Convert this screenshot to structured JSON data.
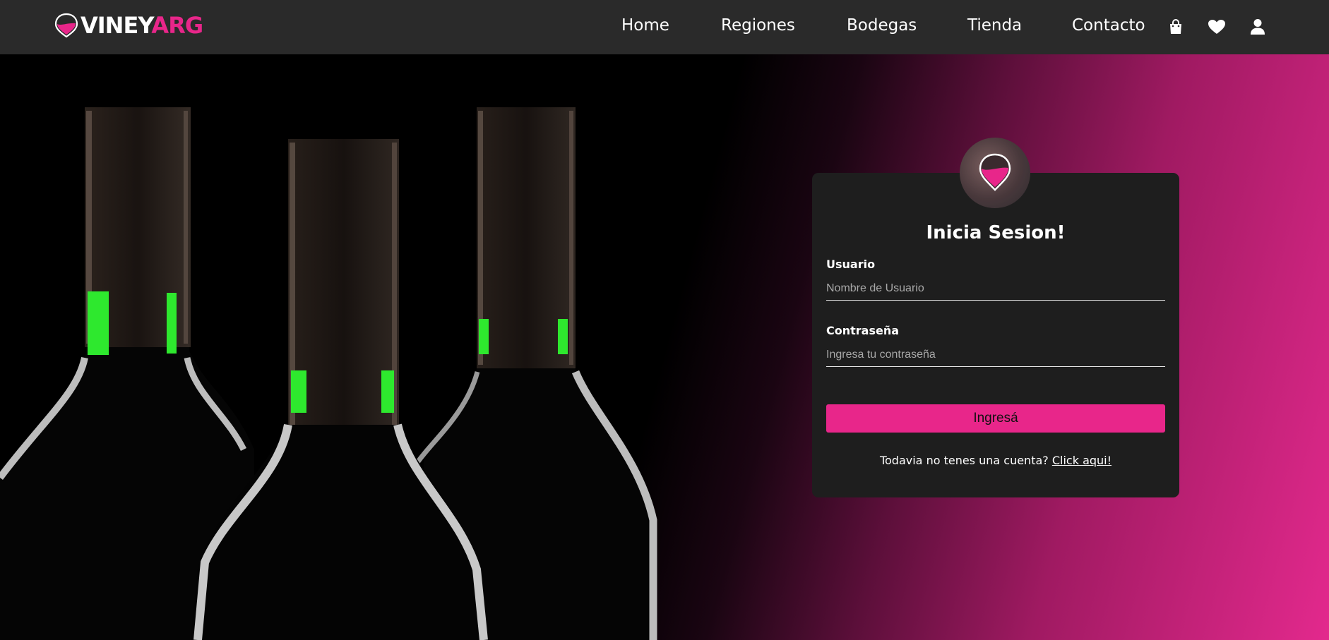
{
  "brand": {
    "logo_part1": "VINEY",
    "logo_part2": "ARG",
    "colors": {
      "accent": "#e8268a",
      "navbar": "#2a2a2a",
      "card": "#1e1e1e"
    }
  },
  "nav": {
    "links": [
      {
        "label": "Home"
      },
      {
        "label": "Regiones"
      },
      {
        "label": "Bodegas"
      },
      {
        "label": "Tienda"
      },
      {
        "label": "Contacto"
      }
    ],
    "icons": [
      "shopping-bag-icon",
      "heart-icon",
      "user-icon"
    ]
  },
  "login": {
    "title": "Inicia Sesion!",
    "username_label": "Usuario",
    "username_placeholder": "Nombre de Usuario",
    "password_label": "Contraseña",
    "password_placeholder": "Ingresa tu contraseña",
    "submit_label": "Ingresá",
    "signup_text": "Todavia no tenes una cuenta?",
    "signup_link": "Click aqui!"
  }
}
